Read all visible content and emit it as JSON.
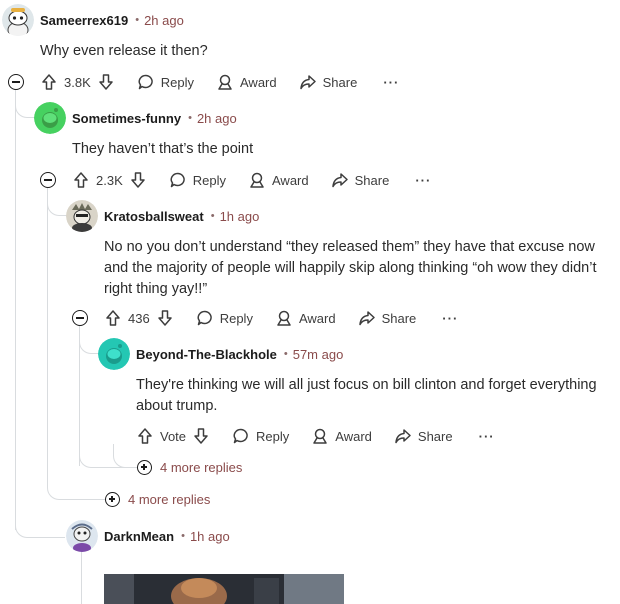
{
  "comments": [
    {
      "author": "Sameerrex619",
      "time": "2h ago",
      "text": "Why even release it then?",
      "votes": "3.8K"
    },
    {
      "author": "Sometimes-funny",
      "time": "2h ago",
      "text": "They haven’t that’s the point",
      "votes": "2.3K"
    },
    {
      "author": "Kratosballsweat",
      "time": "1h ago",
      "text": "No no you don’t understand “they released them” they have that excuse now and the majority of people will happily skip along thinking “oh wow they didn’t right thing yay!!”",
      "votes": "436"
    },
    {
      "author": "Beyond-The-Blackhole",
      "time": "57m ago",
      "text": "They're thinking we will all just focus on bill clinton and forget everything about trump.",
      "votes": "Vote"
    },
    {
      "author": "DarknMean",
      "time": "1h ago"
    }
  ],
  "actions": {
    "reply": "Reply",
    "award": "Award",
    "share": "Share",
    "overflow": "···"
  },
  "more_replies": [
    "4 more replies",
    "4 more replies"
  ],
  "separator": "•",
  "colors": {
    "time": "#8a4b4b",
    "thread": "#d9dcdf",
    "avatar_green": "#46d160",
    "avatar_teal": "#24c7b3"
  },
  "icons": [
    "upvote-icon",
    "downvote-icon",
    "reply-icon",
    "award-icon",
    "share-icon",
    "collapse-icon",
    "expand-icon"
  ]
}
